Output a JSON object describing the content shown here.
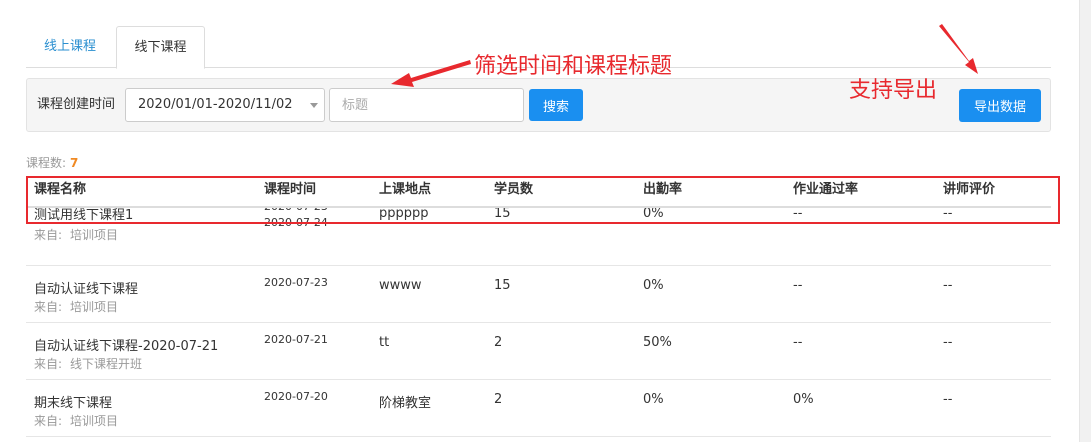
{
  "tabs": [
    {
      "label": "线上课程"
    },
    {
      "label": "线下课程"
    }
  ],
  "filter": {
    "label": "课程创建时间",
    "date_range": "2020/01/01-2020/11/02",
    "title_placeholder": "标题",
    "search_label": "搜索",
    "export_label": "导出数据"
  },
  "annotations": {
    "filter_note": "筛选时间和课程标题",
    "export_note": "支持导出"
  },
  "count": {
    "label": "课程数:",
    "value": "7"
  },
  "table": {
    "headers": [
      "课程名称",
      "课程时间",
      "上课地点",
      "学员数",
      "出勤率",
      "作业通过率",
      "讲师评价"
    ],
    "source_prefix": "来自:",
    "rows": [
      {
        "name": "测试用线下课程1",
        "source": "培训项目",
        "dates": [
          "2020-07-23",
          "2020-07-24"
        ],
        "location": "pppppp",
        "students": "15",
        "attendance": "0%",
        "homework": "--",
        "rating": "--"
      },
      {
        "name": "自动认证线下课程",
        "source": "培训项目",
        "dates": [
          "2020-07-23"
        ],
        "location": "wwww",
        "students": "15",
        "attendance": "0%",
        "homework": "--",
        "rating": "--"
      },
      {
        "name": "自动认证线下课程-2020-07-21",
        "source": "线下课程开班",
        "dates": [
          "2020-07-21"
        ],
        "location": "tt",
        "students": "2",
        "attendance": "50%",
        "homework": "--",
        "rating": "--"
      },
      {
        "name": "期末线下课程",
        "source": "培训项目",
        "dates": [
          "2020-07-20"
        ],
        "location": "阶梯教室",
        "students": "2",
        "attendance": "0%",
        "homework": "0%",
        "rating": "--"
      }
    ]
  },
  "colors": {
    "primary": "#1a8ff0",
    "annotation": "#e8292e",
    "count_value": "#f08a24"
  }
}
